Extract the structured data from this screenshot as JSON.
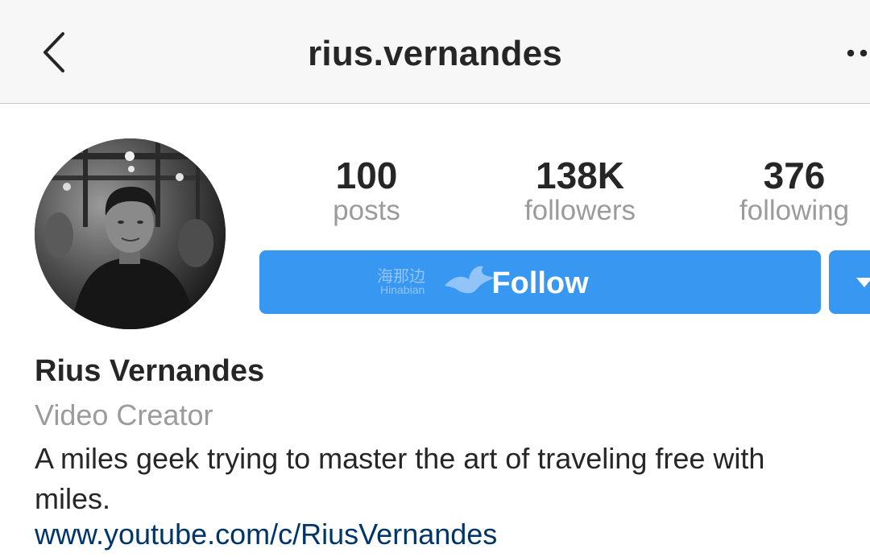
{
  "header": {
    "username": "rius.vernandes",
    "back_icon": "chevron-left-icon",
    "more_icon": "more-horizontal-icon"
  },
  "profile": {
    "avatar": "profile-photo",
    "stats": [
      {
        "value": "100",
        "label": "posts"
      },
      {
        "value": "138K",
        "label": "followers"
      },
      {
        "value": "376",
        "label": "following"
      }
    ],
    "follow_label": "Follow",
    "dropdown_icon": "caret-down-icon",
    "watermark": {
      "cn": "海那边",
      "en": "Hinabian"
    },
    "full_name": "Rius Vernandes",
    "category": "Video Creator",
    "bio_lines": [
      "A miles geek trying to master the art of traveling free with",
      "miles."
    ],
    "website": "www.youtube.com/c/RiusVernandes"
  },
  "colors": {
    "accent": "#3897f0",
    "link": "#003569",
    "muted": "#9b9b9b",
    "text": "#262626"
  }
}
